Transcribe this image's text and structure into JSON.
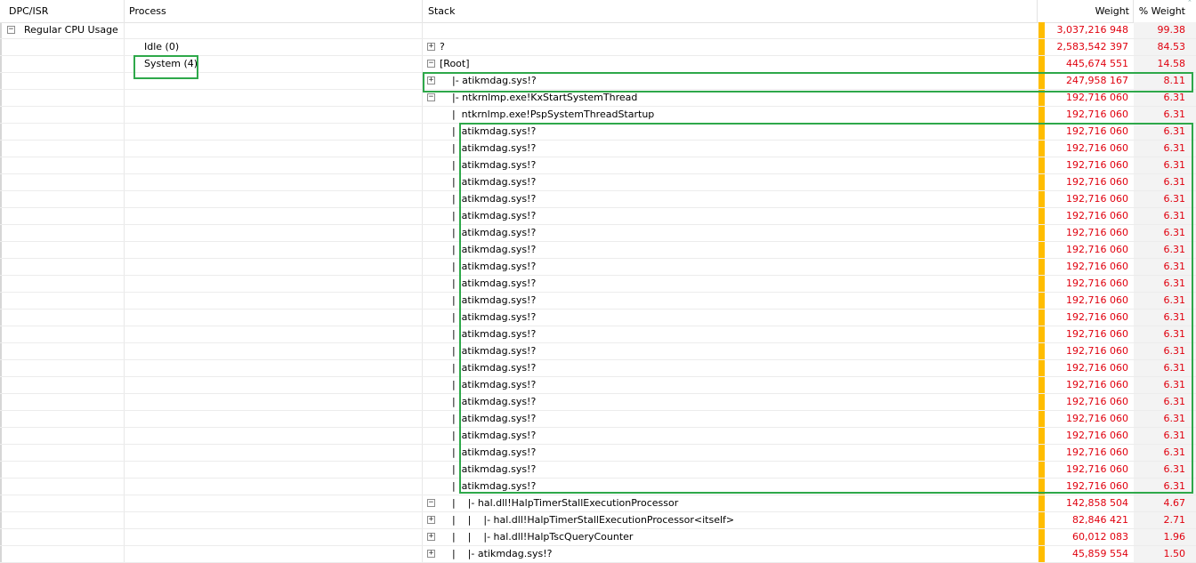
{
  "columns": {
    "dpc": "DPC/ISR",
    "process": "Process",
    "stack": "Stack",
    "weight": "Weight",
    "pct": "% Weight"
  },
  "rows": [
    {
      "dpc": "Regular CPU Usage",
      "dpc_exp": "−",
      "process": "",
      "stack_exp": "",
      "stack": "",
      "weight": "3,037,216 948",
      "pct": "99.38"
    },
    {
      "dpc": "",
      "process": "Idle (0)",
      "stack_exp": "+",
      "stack": "?",
      "weight": "2,583,542 397",
      "pct": "84.53"
    },
    {
      "dpc": "",
      "process": "System (4)",
      "stack_exp": "−",
      "stack": "[Root]",
      "weight": "445,674 551",
      "pct": "14.58"
    },
    {
      "dpc": "",
      "process": "",
      "stack_exp": "+",
      "stack": "    |- atikmdag.sys!?",
      "weight": "247,958 167",
      "pct": "8.11"
    },
    {
      "dpc": "",
      "process": "",
      "stack_exp": "−",
      "stack": "    |- ntkrnlmp.exe!KxStartSystemThread",
      "weight": "192,716 060",
      "pct": "6.31"
    },
    {
      "dpc": "",
      "process": "",
      "stack_exp": "",
      "stack": "    |  ntkrnlmp.exe!PspSystemThreadStartup",
      "weight": "192,716 060",
      "pct": "6.31"
    },
    {
      "dpc": "",
      "process": "",
      "stack_exp": "",
      "stack": "    |  atikmdag.sys!?",
      "weight": "192,716 060",
      "pct": "6.31"
    },
    {
      "dpc": "",
      "process": "",
      "stack_exp": "",
      "stack": "    |  atikmdag.sys!?",
      "weight": "192,716 060",
      "pct": "6.31"
    },
    {
      "dpc": "",
      "process": "",
      "stack_exp": "",
      "stack": "    |  atikmdag.sys!?",
      "weight": "192,716 060",
      "pct": "6.31"
    },
    {
      "dpc": "",
      "process": "",
      "stack_exp": "",
      "stack": "    |  atikmdag.sys!?",
      "weight": "192,716 060",
      "pct": "6.31"
    },
    {
      "dpc": "",
      "process": "",
      "stack_exp": "",
      "stack": "    |  atikmdag.sys!?",
      "weight": "192,716 060",
      "pct": "6.31"
    },
    {
      "dpc": "",
      "process": "",
      "stack_exp": "",
      "stack": "    |  atikmdag.sys!?",
      "weight": "192,716 060",
      "pct": "6.31"
    },
    {
      "dpc": "",
      "process": "",
      "stack_exp": "",
      "stack": "    |  atikmdag.sys!?",
      "weight": "192,716 060",
      "pct": "6.31"
    },
    {
      "dpc": "",
      "process": "",
      "stack_exp": "",
      "stack": "    |  atikmdag.sys!?",
      "weight": "192,716 060",
      "pct": "6.31"
    },
    {
      "dpc": "",
      "process": "",
      "stack_exp": "",
      "stack": "    |  atikmdag.sys!?",
      "weight": "192,716 060",
      "pct": "6.31"
    },
    {
      "dpc": "",
      "process": "",
      "stack_exp": "",
      "stack": "    |  atikmdag.sys!?",
      "weight": "192,716 060",
      "pct": "6.31"
    },
    {
      "dpc": "",
      "process": "",
      "stack_exp": "",
      "stack": "    |  atikmdag.sys!?",
      "weight": "192,716 060",
      "pct": "6.31"
    },
    {
      "dpc": "",
      "process": "",
      "stack_exp": "",
      "stack": "    |  atikmdag.sys!?",
      "weight": "192,716 060",
      "pct": "6.31"
    },
    {
      "dpc": "",
      "process": "",
      "stack_exp": "",
      "stack": "    |  atikmdag.sys!?",
      "weight": "192,716 060",
      "pct": "6.31"
    },
    {
      "dpc": "",
      "process": "",
      "stack_exp": "",
      "stack": "    |  atikmdag.sys!?",
      "weight": "192,716 060",
      "pct": "6.31"
    },
    {
      "dpc": "",
      "process": "",
      "stack_exp": "",
      "stack": "    |  atikmdag.sys!?",
      "weight": "192,716 060",
      "pct": "6.31"
    },
    {
      "dpc": "",
      "process": "",
      "stack_exp": "",
      "stack": "    |  atikmdag.sys!?",
      "weight": "192,716 060",
      "pct": "6.31"
    },
    {
      "dpc": "",
      "process": "",
      "stack_exp": "",
      "stack": "    |  atikmdag.sys!?",
      "weight": "192,716 060",
      "pct": "6.31"
    },
    {
      "dpc": "",
      "process": "",
      "stack_exp": "",
      "stack": "    |  atikmdag.sys!?",
      "weight": "192,716 060",
      "pct": "6.31"
    },
    {
      "dpc": "",
      "process": "",
      "stack_exp": "",
      "stack": "    |  atikmdag.sys!?",
      "weight": "192,716 060",
      "pct": "6.31"
    },
    {
      "dpc": "",
      "process": "",
      "stack_exp": "",
      "stack": "    |  atikmdag.sys!?",
      "weight": "192,716 060",
      "pct": "6.31"
    },
    {
      "dpc": "",
      "process": "",
      "stack_exp": "",
      "stack": "    |  atikmdag.sys!?",
      "weight": "192,716 060",
      "pct": "6.31"
    },
    {
      "dpc": "",
      "process": "",
      "stack_exp": "",
      "stack": "    |  atikmdag.sys!?",
      "weight": "192,716 060",
      "pct": "6.31"
    },
    {
      "dpc": "",
      "process": "",
      "stack_exp": "−",
      "stack": "    |    |- hal.dll!HalpTimerStallExecutionProcessor",
      "weight": "142,858 504",
      "pct": "4.67"
    },
    {
      "dpc": "",
      "process": "",
      "stack_exp": "+",
      "stack": "    |    |    |- hal.dll!HalpTimerStallExecutionProcessor<itself>",
      "weight": "82,846 421",
      "pct": "2.71"
    },
    {
      "dpc": "",
      "process": "",
      "stack_exp": "+",
      "stack": "    |    |    |- hal.dll!HalpTscQueryCounter",
      "weight": "60,012 083",
      "pct": "1.96"
    },
    {
      "dpc": "",
      "process": "",
      "stack_exp": "+",
      "stack": "    |    |- atikmdag.sys!?",
      "weight": "45,859 554",
      "pct": "1.50"
    }
  ],
  "colors": {
    "weight_text": "#e0000e",
    "weight_bar": "#ffbd00",
    "highlight_box": "#2ea84a"
  }
}
